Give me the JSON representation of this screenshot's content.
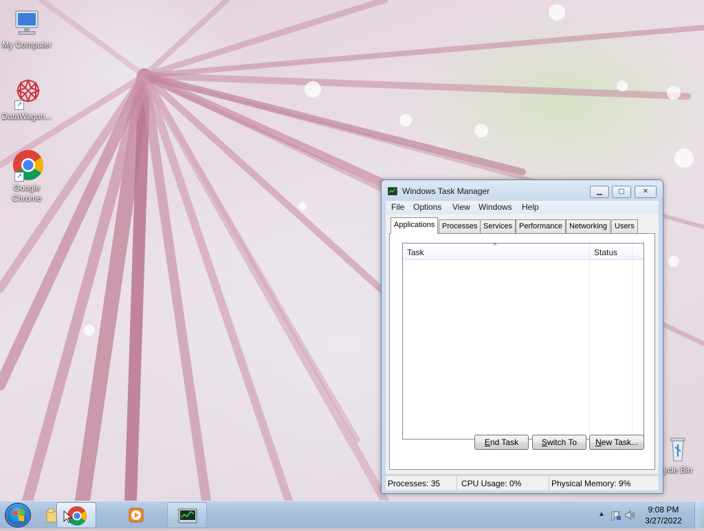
{
  "desktop": {
    "icons": [
      {
        "label": "My Computer",
        "icon": "computer-icon"
      },
      {
        "label": "DataWagon...",
        "icon": "datawagon-icon"
      },
      {
        "label": "Google Chrome",
        "icon": "chrome-icon"
      },
      {
        "label": "ycle Bin",
        "icon": "recycle-bin-icon"
      }
    ]
  },
  "task_manager": {
    "title": "Windows Task Manager",
    "menu": [
      "File",
      "Options",
      "View",
      "Windows",
      "Help"
    ],
    "tabs": [
      "Applications",
      "Processes",
      "Services",
      "Performance",
      "Networking",
      "Users"
    ],
    "selected_tab": "Applications",
    "columns": [
      "Task",
      "Status"
    ],
    "buttons": {
      "end_task": {
        "accel": "E",
        "rest": "nd Task"
      },
      "switch_to": {
        "accel": "S",
        "rest": "witch To"
      },
      "new_task": {
        "accel": "N",
        "rest": "ew Task..."
      }
    },
    "status": {
      "processes": "Processes: 35",
      "cpu": "CPU Usage: 0%",
      "memory": "Physical Memory: 9%"
    }
  },
  "taskbar": {
    "pinned": [
      "file-explorer-icon",
      "chrome-icon",
      "media-player-icon",
      "task-manager-icon"
    ],
    "time": "9:08 PM",
    "date": "3/27/2022"
  },
  "colors": {
    "taskbar": "#a6bfdc",
    "window_frame": "#c9d9ec",
    "selection_header": "#f1f5fb"
  }
}
